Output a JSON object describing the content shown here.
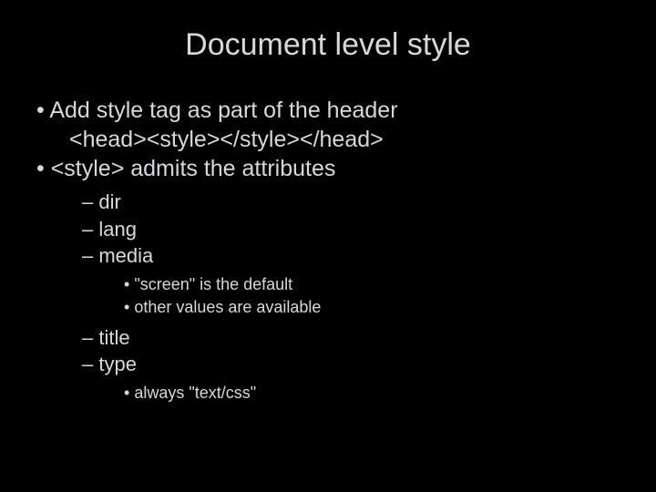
{
  "title": "Document level style",
  "bullets": {
    "b1": "Add style tag as part of the header",
    "code": "<head><style></style></head>",
    "b2": "<style> admits the attributes",
    "attrs": {
      "a1": "dir",
      "a2": "lang",
      "a3": "media",
      "a3_sub1": "\"screen\" is the default",
      "a3_sub2": "other values are available",
      "a4": "title",
      "a5": "type",
      "a5_sub1": "always \"text/css\""
    }
  }
}
